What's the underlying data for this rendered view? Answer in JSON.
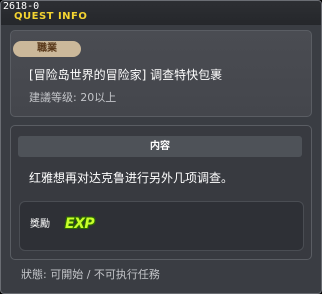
{
  "window": {
    "quest_id": "2618-0",
    "title": "QUEST INFO"
  },
  "quest": {
    "category_badge": "職業",
    "name": "[冒险岛世界的冒险家] 调查特快包裹",
    "level_requirement": "建議等级: 20以上"
  },
  "content": {
    "header": "内容",
    "description": "红雅想再对达克鲁进行另外几项调查。"
  },
  "reward": {
    "label": "獎勵",
    "icon_text": "EXP"
  },
  "status": {
    "text": "狀態: 可開始 / 不可执行任務"
  }
}
